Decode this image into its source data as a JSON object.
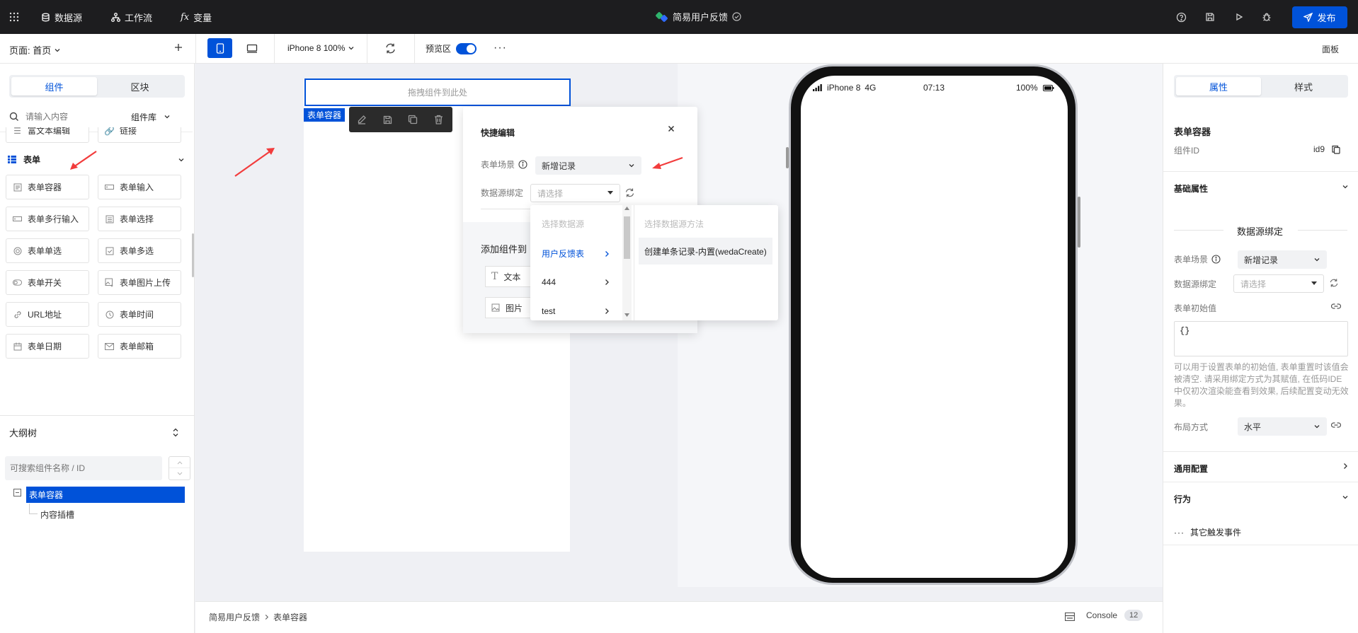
{
  "topbar": {
    "datasource": "数据源",
    "workflow": "工作流",
    "variable": "变量",
    "app_title": "简易用户反馈",
    "publish": "发布"
  },
  "toolbar": {
    "page_label": "页面: 首页",
    "device": "iPhone 8 100%",
    "preview": "预览区",
    "panel": "面板"
  },
  "left": {
    "tabs": [
      "组件",
      "区块"
    ],
    "search_placeholder": "请输入内容",
    "library": "组件库",
    "partial_items": [
      "富文本编辑",
      "链接"
    ],
    "section": "表单",
    "items": [
      "表单容器",
      "表单输入",
      "表单多行输入",
      "表单选择",
      "表单单选",
      "表单多选",
      "表单开关",
      "表单图片上传",
      "URL地址",
      "表单时间",
      "表单日期",
      "表单邮箱"
    ],
    "outline_title": "大纲树",
    "outline_placeholder": "可搜索组件名称 / ID",
    "tree_root": "表单容器",
    "tree_child": "内容插槽"
  },
  "canvas": {
    "dropzone": "拖拽组件到此处",
    "tag": "表单容器"
  },
  "quickedit": {
    "title": "快捷编辑",
    "scene_label": "表单场景",
    "scene_value": "新增记录",
    "bind_label": "数据源绑定",
    "bind_placeholder": "请选择",
    "add_label": "添加组件到",
    "add_items": [
      "文本",
      "图片"
    ]
  },
  "cascader": {
    "col1_header": "选择数据源",
    "col1_items": [
      "用户反馈表",
      "444",
      "test"
    ],
    "col2_header": "选择数据源方法",
    "col2_item": "创建单条记录-内置(wedaCreate)"
  },
  "phone": {
    "carrier": "iPhone 8",
    "network": "4G",
    "time": "07:13",
    "battery": "100%"
  },
  "right": {
    "tabs": [
      "属性",
      "样式"
    ],
    "comp_title": "表单容器",
    "id_label": "组件ID",
    "id_value": "id9",
    "basic": "基础属性",
    "bind_header": "数据源绑定",
    "scene_label": "表单场景",
    "scene_value": "新增记录",
    "bind_label": "数据源绑定",
    "bind_placeholder": "请选择",
    "init_label": "表单初始值",
    "init_value": "{}",
    "hint": "可以用于设置表单的初始值, 表单重置时该值会被清空. 请采用绑定方式为其赋值, 在低码IDE中仅初次渲染能查看到效果, 后续配置变动无效果。",
    "layout_label": "布局方式",
    "layout_value": "水平",
    "general": "通用配置",
    "behavior": "行为",
    "other_events": "其它触发事件"
  },
  "bottom": {
    "crumb1": "简易用户反馈",
    "crumb2": "表单容器",
    "console": "Console",
    "count": "12"
  },
  "colors": {
    "accent": "#0052d9",
    "topbar": "#1d1d1f",
    "annotation": "#f23c3c"
  }
}
